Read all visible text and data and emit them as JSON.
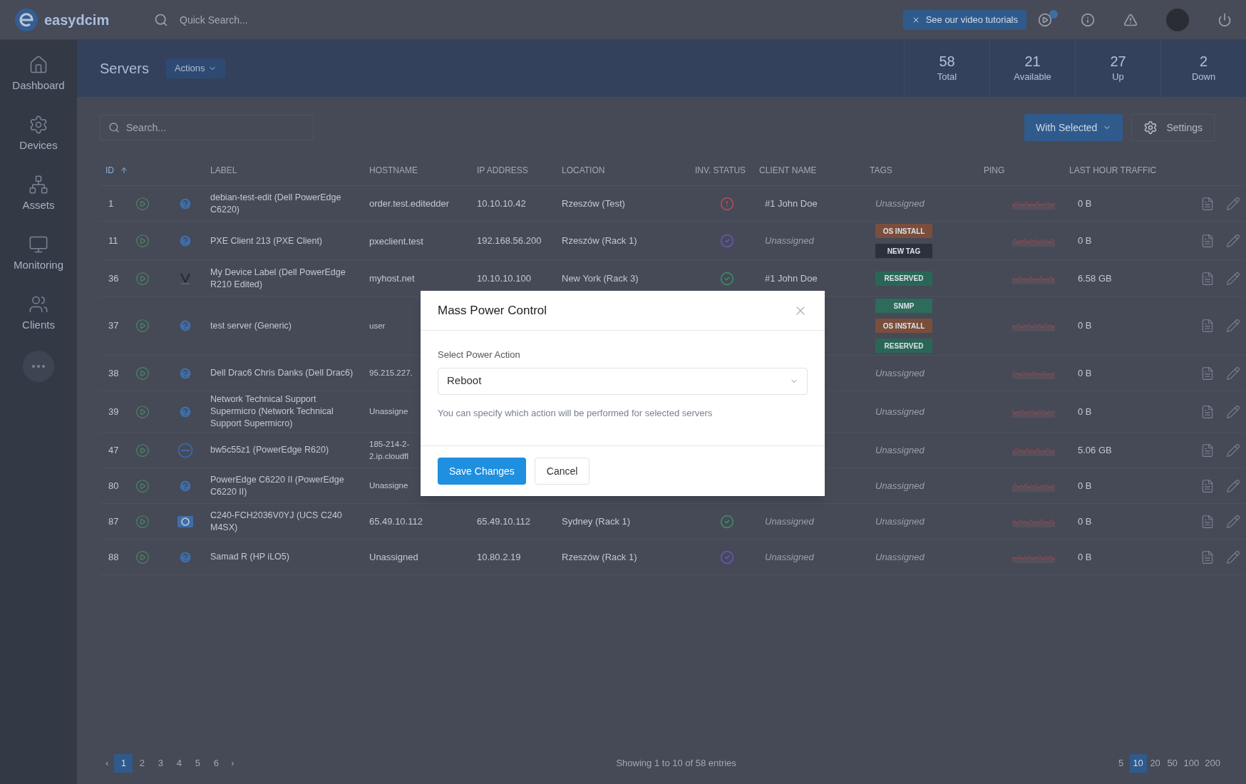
{
  "topbar": {
    "logo": "easydcim",
    "search": {
      "placeholder": "Quick Search..."
    },
    "tutorials_button": "See our video tutorials"
  },
  "sidebar": {
    "items": [
      {
        "label": "Dashboard"
      },
      {
        "label": "Devices"
      },
      {
        "label": "Assets"
      },
      {
        "label": "Monitoring"
      },
      {
        "label": "Clients"
      }
    ]
  },
  "header": {
    "title": "Servers",
    "actions_button": "Actions",
    "stats": [
      {
        "value": "58",
        "label": "Total"
      },
      {
        "value": "21",
        "label": "Available"
      },
      {
        "value": "27",
        "label": "Up"
      },
      {
        "value": "2",
        "label": "Down"
      }
    ]
  },
  "toolbar": {
    "search": {
      "placeholder": "Search..."
    },
    "with_selected_button": "With Selected",
    "settings_button": "Settings"
  },
  "table": {
    "columns": [
      {
        "label": "ID",
        "sorted": true
      },
      {
        "label": "LABEL",
        "sorted": false
      },
      {
        "label": "HOSTNAME",
        "sorted": false
      },
      {
        "label": "IP ADDRESS",
        "sorted": false
      },
      {
        "label": "LOCATION",
        "sorted": false
      },
      {
        "label": "INV. STATUS",
        "sorted": false
      },
      {
        "label": "CLIENT NAME",
        "sorted": false
      },
      {
        "label": "TAGS",
        "sorted": false
      },
      {
        "label": "PING",
        "sorted": false
      },
      {
        "label": "LAST HOUR TRAFFIC",
        "sorted": false
      }
    ],
    "rows": [
      {
        "id": "1",
        "kind": "unknown",
        "label": "debian-test-edit (Dell PowerEdge C6220)",
        "hostname": "order.test.editedder",
        "ip": "10.10.10.42",
        "location": "Rzeszów (Test)",
        "inv_status": {
          "kind": "alert",
          "color": "#b24a58"
        },
        "client": {
          "text": "#1 John Doe",
          "muted": false
        },
        "tags_placeholder": "Unassigned",
        "traffic": "0 B"
      },
      {
        "id": "11",
        "kind": "unknown",
        "label": "PXE Client 213 (PXE Client)",
        "hostname": "pxeclient.test",
        "ip": "192.168.56.200",
        "location": "Rzeszów (Rack 1)",
        "inv_status": {
          "kind": "check",
          "color": "#6a54b8"
        },
        "client": {
          "text": "Unassigned",
          "muted": true
        },
        "tags": [
          {
            "label": "OS INSTALL",
            "color": "#7a4e3c"
          },
          {
            "label": "NEW TAG",
            "color": "#2b303c"
          }
        ],
        "traffic": "0 B"
      },
      {
        "id": "36",
        "kind": "v-logo",
        "label": "My Device Label (Dell PowerEdge R210 Edited)",
        "hostname": "myhost.net",
        "ip": "10.10.10.100",
        "location": "New York (Rack 3)",
        "inv_status": {
          "kind": "check",
          "color": "#3f8a64"
        },
        "client": {
          "text": "#1 John Doe",
          "muted": false
        },
        "tags": [
          {
            "label": "RESERVED",
            "color": "#2a6656"
          }
        ],
        "traffic": "6.58 GB"
      },
      {
        "id": "37",
        "kind": "unknown",
        "label": "test server (Generic)",
        "hostname": "user",
        "tags": [
          {
            "label": "SNMP",
            "color": "#2d6b5a"
          },
          {
            "label": "OS INSTALL",
            "color": "#7a4e3c"
          },
          {
            "label": "RESERVED",
            "color": "#2a6656"
          }
        ],
        "traffic": "0 B"
      },
      {
        "id": "38",
        "kind": "unknown",
        "label": "Dell Drac6 Chris Danks (Dell Drac6)",
        "hostname": "95.215.227.",
        "tags_placeholder": "Unassigned",
        "traffic": "0 B"
      },
      {
        "id": "39",
        "kind": "unknown",
        "label": "Network Technical Support Supermicro (Network Technical Support Supermicro)",
        "hostname": "Unassigne",
        "tags_placeholder": "Unassigned",
        "traffic": "0 B"
      },
      {
        "id": "47",
        "kind": "dell",
        "label": "bw5c55z1 (PowerEdge R620)",
        "hostname": "185-214-2-2.ip.cloudfl",
        "tags_placeholder": "Unassigned",
        "traffic": "5.06 GB"
      },
      {
        "id": "80",
        "kind": "unknown",
        "label": "PowerEdge C6220 II (PowerEdge C6220 II)",
        "hostname": "Unassigne",
        "tags_placeholder": "Unassigned",
        "traffic": "0 B"
      },
      {
        "id": "87",
        "kind": "hp",
        "label": "C240-FCH2036V0YJ (UCS C240 M4SX)",
        "hostname": "65.49.10.112",
        "ip": "65.49.10.112",
        "location": "Sydney (Rack 1)",
        "inv_status": {
          "kind": "check",
          "color": "#3f8a64"
        },
        "client": {
          "text": "Unassigned",
          "muted": true
        },
        "tags_placeholder": "Unassigned",
        "traffic": "0 B"
      },
      {
        "id": "88",
        "kind": "unknown",
        "label": "Samad R (HP iLO5)",
        "hostname": "Unassigned",
        "ip": "10.80.2.19",
        "location": "Rzeszów (Rack 1)",
        "inv_status": {
          "kind": "check",
          "color": "#6a54b8"
        },
        "client": {
          "text": "Unassigned",
          "muted": true
        },
        "tags_placeholder": "Unassigned",
        "traffic": "0 B"
      }
    ]
  },
  "pagination": {
    "prev": "‹",
    "next": "›",
    "pages": [
      {
        "label": "1",
        "selected": true
      },
      {
        "label": "2",
        "selected": false
      },
      {
        "label": "3",
        "selected": false
      },
      {
        "label": "4",
        "selected": false
      },
      {
        "label": "5",
        "selected": false
      },
      {
        "label": "6",
        "selected": false
      }
    ],
    "summary": "Showing 1 to 10 of 58 entries",
    "page_sizes": [
      {
        "label": "5",
        "selected": false
      },
      {
        "label": "10",
        "selected": true
      },
      {
        "label": "20",
        "selected": false
      },
      {
        "label": "50",
        "selected": false
      },
      {
        "label": "100",
        "selected": false
      },
      {
        "label": "200",
        "selected": false
      }
    ]
  },
  "modal": {
    "title": "Mass Power Control",
    "field_label": "Select Power Action",
    "select_value": "Reboot",
    "hint": "You can specify which action will be performed for selected servers",
    "save_button": "Save Changes",
    "cancel_button": "Cancel"
  }
}
